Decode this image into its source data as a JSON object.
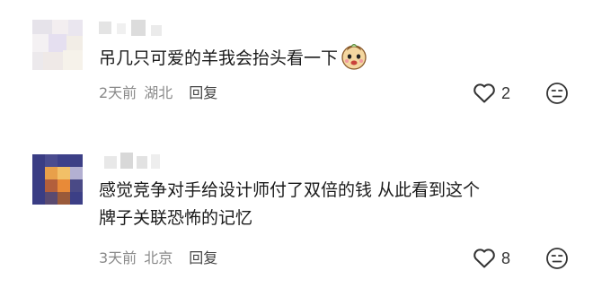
{
  "comments": [
    {
      "text_lines": [
        "吊几只可爱的羊我会抬头看一下"
      ],
      "emoji": "sheep-face-emoji",
      "time": "2天前",
      "location": "湖北",
      "reply_label": "回复",
      "like_count": "2"
    },
    {
      "text_lines": [
        "感觉竞争对手给设计师付了双倍的钱 从此看到这个",
        "牌子关联恐怖的记忆"
      ],
      "time": "3天前",
      "location": "北京",
      "reply_label": "回复",
      "like_count": "8"
    }
  ],
  "icons": {
    "like": "heart-outline-icon",
    "dislike": "dislike-face-icon"
  },
  "colors": {
    "text": "#1a1a1a",
    "meta": "#8a8a8a",
    "icon": "#333333"
  }
}
